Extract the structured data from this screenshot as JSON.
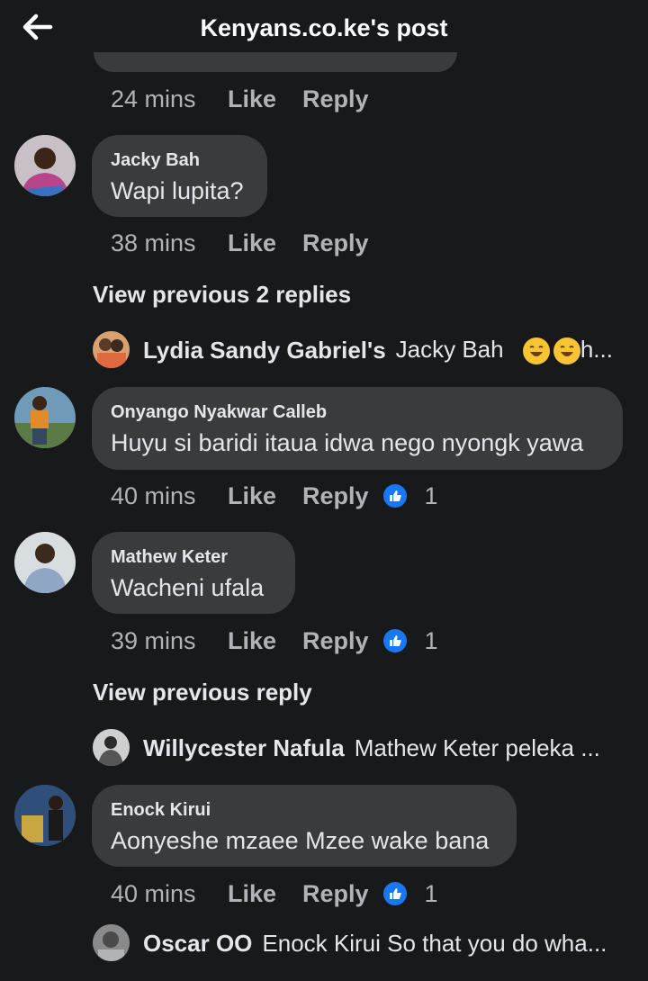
{
  "header": {
    "title": "Kenyans.co.ke's post",
    "back_icon": "arrow-left-icon"
  },
  "top_meta": {
    "time": "24 mins",
    "like": "Like",
    "reply": "Reply"
  },
  "comments": [
    {
      "author": "Jacky Bah",
      "text": "Wapi lupita?",
      "time": "38 mins",
      "like": "Like",
      "reply": "Reply"
    },
    {
      "author": "Onyango Nyakwar Calleb",
      "text": "Huyu si baridi itaua  idwa nego nyongk yawa",
      "time": "40 mins",
      "like": "Like",
      "reply": "Reply",
      "reactions": "1"
    },
    {
      "author": "Mathew Keter",
      "text": "Wacheni  ufala",
      "time": "39 mins",
      "like": "Like",
      "reply": "Reply",
      "reactions": "1"
    },
    {
      "author": "Enock Kirui",
      "text": "Aonyeshe mzaee Mzee wake bana",
      "time": "40 mins",
      "like": "Like",
      "reply": "Reply",
      "reactions": "1"
    }
  ],
  "view_previous": [
    "View previous 2 replies",
    "View previous reply"
  ],
  "replies": [
    {
      "name": "Lydia Sandy Gabriel's",
      "text": "Jacky Bah",
      "suffix": "h..."
    },
    {
      "name": "Willycester Nafula",
      "text": "Mathew Keter peleka ..."
    },
    {
      "name": "Oscar OO",
      "text": "Enock Kirui So that you do wha..."
    }
  ],
  "colors": {
    "background": "#18191a",
    "bubble": "#3a3b3c",
    "accent": "#1877f2",
    "secondary_text": "#b0b3b8"
  }
}
